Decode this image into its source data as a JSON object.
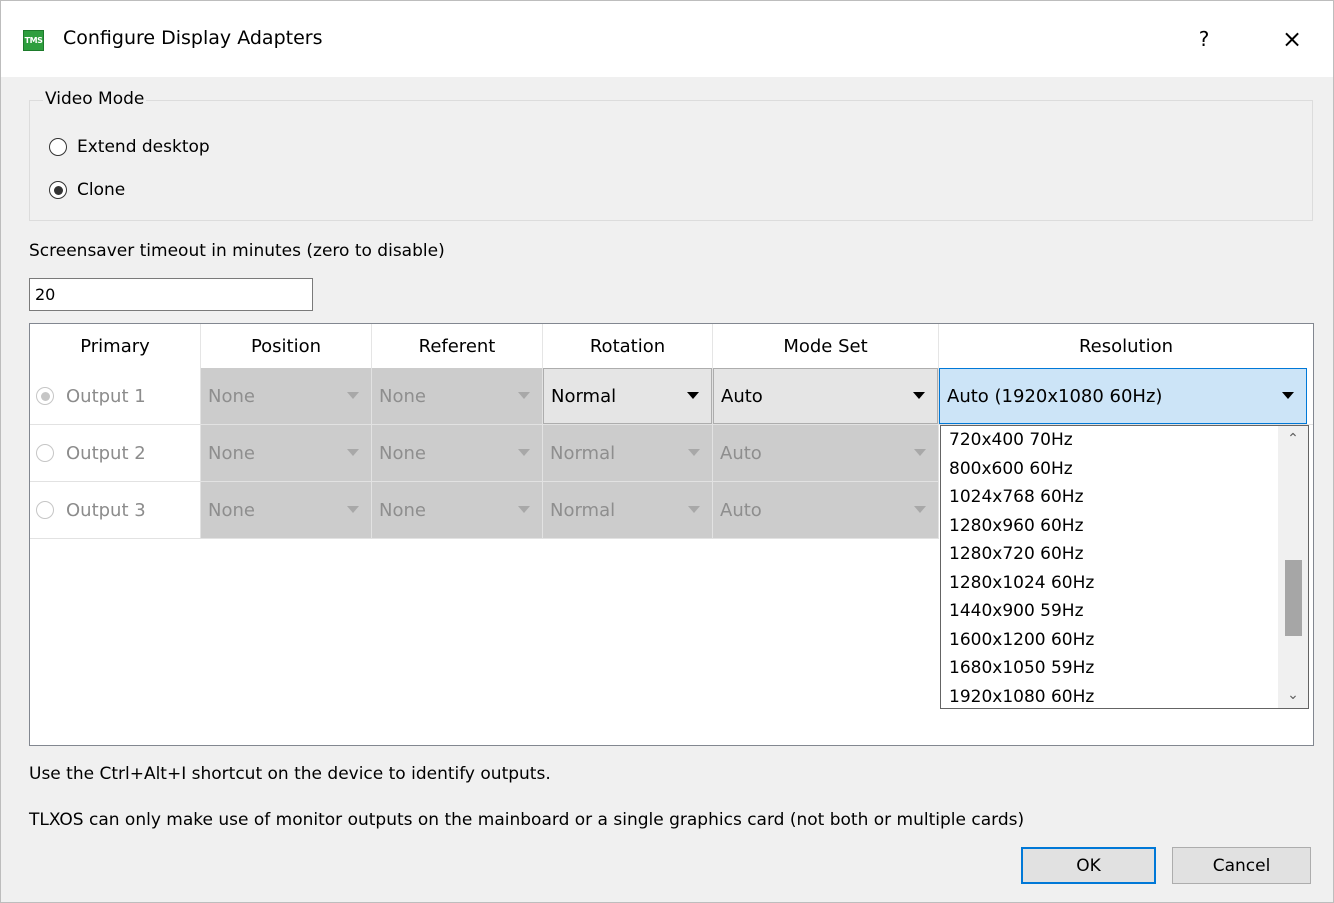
{
  "window": {
    "title": "Configure Display Adapters",
    "icon_text": "TMS",
    "help_label": "?",
    "close_label": "×"
  },
  "video_mode": {
    "label": "Video Mode",
    "options": [
      {
        "label": "Extend desktop",
        "checked": false
      },
      {
        "label": "Clone",
        "checked": true
      }
    ]
  },
  "screensaver": {
    "label": "Screensaver timeout in minutes (zero to disable)",
    "value": "20"
  },
  "table": {
    "columns": [
      "Primary",
      "Position",
      "Referent",
      "Rotation",
      "Mode Set",
      "Resolution"
    ],
    "rows": [
      {
        "primary": "Output 1",
        "selected": true,
        "position": "None",
        "referent": "None",
        "rotation": "Normal",
        "mode_set": "Auto",
        "resolution": "Auto (1920x1080 60Hz)"
      },
      {
        "primary": "Output 2",
        "selected": false,
        "position": "None",
        "referent": "None",
        "rotation": "Normal",
        "mode_set": "Auto",
        "resolution": ""
      },
      {
        "primary": "Output 3",
        "selected": false,
        "position": "None",
        "referent": "None",
        "rotation": "Normal",
        "mode_set": "Auto",
        "resolution": ""
      }
    ]
  },
  "resolution_dropdown": {
    "items": [
      "720x400 70Hz",
      "800x600 60Hz",
      "1024x768 60Hz",
      "1280x960 60Hz",
      "1280x720 60Hz",
      "1280x1024 60Hz",
      "1440x900 59Hz",
      "1600x1200 60Hz",
      "1680x1050 59Hz",
      "1920x1080 60Hz"
    ],
    "scroll_position": 0.65,
    "visible_fraction": 0.5
  },
  "notes": {
    "shortcut": "Use the Ctrl+Alt+I shortcut on the device to identify outputs.",
    "limitation": "TLXOS can only make use of monitor outputs on the mainboard or a single graphics card (not both or multiple cards)"
  },
  "buttons": {
    "ok": "OK",
    "cancel": "Cancel"
  },
  "colors": {
    "accent": "#0078d7",
    "focused_bg": "#cce4f7",
    "disabled_bg": "#cccccc",
    "icon_green": "#2e9e3e"
  }
}
